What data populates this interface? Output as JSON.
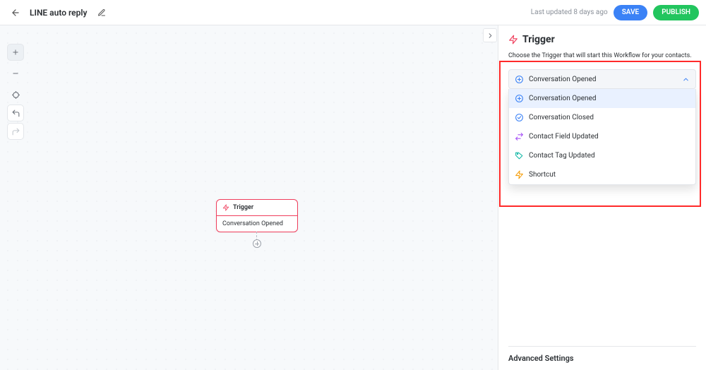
{
  "header": {
    "title": "LINE auto reply",
    "last_updated": "Last updated 8 days ago",
    "save_label": "SAVE",
    "publish_label": "PUBLISH"
  },
  "canvas": {
    "node": {
      "title": "Trigger",
      "body": "Conversation Opened"
    }
  },
  "panel": {
    "title": "Trigger",
    "description": "Choose the Trigger that will start this Workflow for your contacts.",
    "selected": "Conversation Opened",
    "options": [
      {
        "label": "Conversation Opened",
        "icon": "plus-circle",
        "color": "ic-blue"
      },
      {
        "label": "Conversation Closed",
        "icon": "check-circle",
        "color": "ic-blue"
      },
      {
        "label": "Contact Field Updated",
        "icon": "swap",
        "color": "ic-purple"
      },
      {
        "label": "Contact Tag Updated",
        "icon": "tag",
        "color": "ic-teal"
      },
      {
        "label": "Shortcut",
        "icon": "bolt",
        "color": "ic-orange"
      }
    ],
    "advanced_label": "Advanced Settings"
  }
}
